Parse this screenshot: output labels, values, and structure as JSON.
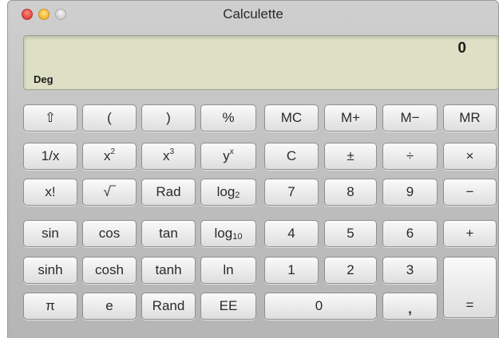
{
  "window": {
    "title": "Calculette"
  },
  "display": {
    "value": "0",
    "mode": "Deg"
  },
  "buttons": {
    "shift": "⇧",
    "paren_open": "(",
    "paren_close": ")",
    "percent": "%",
    "mc": "MC",
    "mplus": "M+",
    "mminus": "M−",
    "mr": "MR",
    "reciprocal": "1/x",
    "x_base": "x",
    "x2_sup": "2",
    "x3_sup": "3",
    "y_base": "y",
    "y_sup": "x",
    "clear": "C",
    "plusminus": "±",
    "divide": "÷",
    "multiply": "×",
    "factorial": "x!",
    "sqrt": "√‾",
    "rad": "Rad",
    "log_base": "log",
    "log2_sub": "2",
    "seven": "7",
    "eight": "8",
    "nine": "9",
    "minus": "−",
    "sin": "sin",
    "cos": "cos",
    "tan": "tan",
    "log10_sub": "10",
    "four": "4",
    "five": "5",
    "six": "6",
    "plus": "+",
    "sinh": "sinh",
    "cosh": "cosh",
    "tanh": "tanh",
    "ln": "ln",
    "one": "1",
    "two": "2",
    "three": "3",
    "pi": "π",
    "e": "e",
    "rand": "Rand",
    "ee": "EE",
    "zero": "0",
    "decimal": ",",
    "equals": "="
  }
}
